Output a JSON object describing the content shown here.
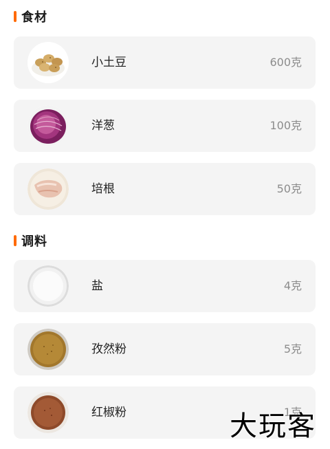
{
  "sections": [
    {
      "title": "食材",
      "items": [
        {
          "name": "小土豆",
          "amount": "600克",
          "icon": "potatoes-icon"
        },
        {
          "name": "洋葱",
          "amount": "100克",
          "icon": "onion-icon"
        },
        {
          "name": "培根",
          "amount": "50克",
          "icon": "bacon-icon"
        }
      ]
    },
    {
      "title": "调料",
      "items": [
        {
          "name": "盐",
          "amount": "4克",
          "icon": "salt-icon"
        },
        {
          "name": "孜然粉",
          "amount": "5克",
          "icon": "cumin-powder-icon"
        },
        {
          "name": "红椒粉",
          "amount": "1克",
          "icon": "paprika-powder-icon"
        }
      ]
    }
  ],
  "watermark": "大玩客",
  "colors": {
    "accent": "#ff6a00",
    "row_background": "#f4f4f4",
    "amount_text": "#8c8c8c"
  }
}
